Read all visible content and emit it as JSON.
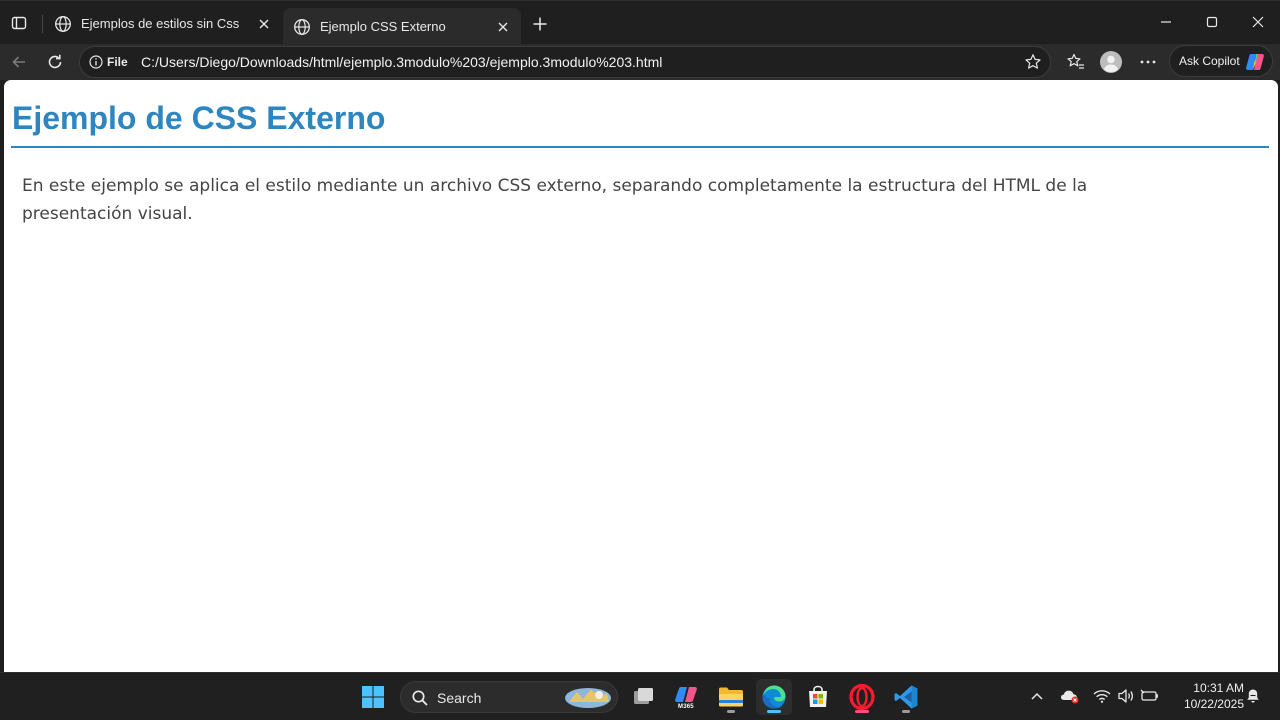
{
  "browser": {
    "tabs": [
      {
        "title": "Ejemplos de estilos sin Css",
        "active": false
      },
      {
        "title": "Ejemplo CSS Externo",
        "active": true
      }
    ],
    "address": {
      "scheme_label": "File",
      "url": "C:/Users/Diego/Downloads/html/ejemplo.3modulo%203/ejemplo.3modulo%203.html"
    },
    "copilot_label": "Ask Copilot"
  },
  "page": {
    "heading": "Ejemplo de CSS Externo",
    "paragraph": "En este ejemplo se aplica el estilo mediante un archivo CSS externo, separando completamente la estructura del HTML de la presentación visual.",
    "heading_color": "#2e86c1"
  },
  "taskbar": {
    "search_label": "Search",
    "m365_label": "M365",
    "time": "10:31 AM",
    "date": "10/22/2025",
    "icons": [
      "windows-start-icon",
      "search-icon",
      "task-view-icon",
      "m365-copilot-icon",
      "file-explorer-icon",
      "edge-icon",
      "microsoft-store-icon",
      "opera-icon",
      "vscode-icon"
    ],
    "tray_icons": [
      "chevron-up-icon",
      "onedrive-icon",
      "wifi-icon",
      "volume-icon",
      "battery-icon",
      "notification-icon"
    ]
  }
}
